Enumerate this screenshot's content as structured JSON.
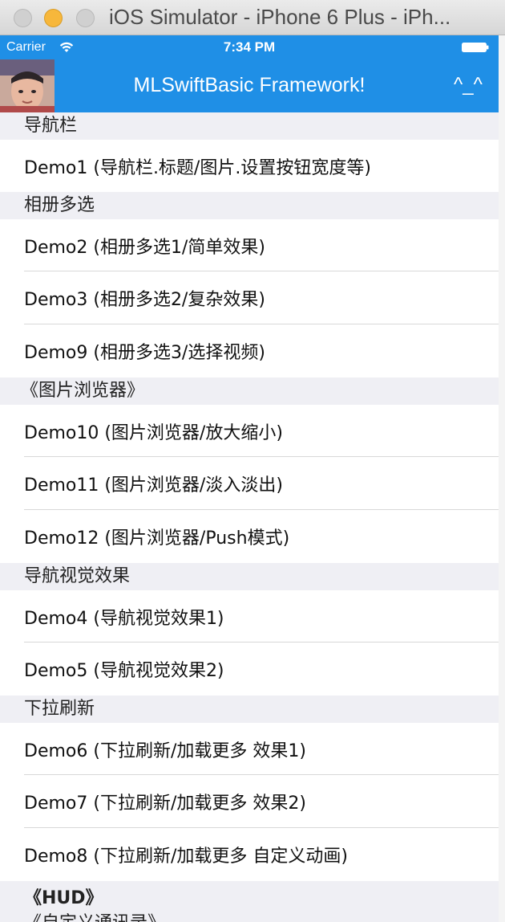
{
  "window": {
    "title": "iOS Simulator - iPhone 6 Plus - iPh..."
  },
  "status_bar": {
    "carrier": "Carrier",
    "time": "7:34 PM"
  },
  "nav_bar": {
    "title": "MLSwiftBasic Framework!",
    "right_button": "^_^",
    "color": "#1f8fe6"
  },
  "sections": [
    {
      "header": "导航栏",
      "rows": [
        "Demo1 (导航栏.标题/图片.设置按钮宽度等)"
      ]
    },
    {
      "header": "相册多选",
      "rows": [
        "Demo2 (相册多选1/简单效果)",
        "Demo3 (相册多选2/复杂效果)",
        "Demo9 (相册多选3/选择视频)"
      ]
    },
    {
      "header": "《图片浏览器》",
      "rows": [
        "Demo10 (图片浏览器/放大缩小)",
        "Demo11 (图片浏览器/淡入淡出)",
        "Demo12 (图片浏览器/Push模式)"
      ]
    },
    {
      "header": "导航视觉效果",
      "rows": [
        "Demo4 (导航视觉效果1)",
        "Demo5 (导航视觉效果2)"
      ]
    },
    {
      "header": "下拉刷新",
      "rows": [
        "Demo6 (下拉刷新/加载更多 效果1)",
        "Demo7 (下拉刷新/加载更多 效果2)",
        "Demo8 (下拉刷新/加载更多 自定义动画)"
      ]
    }
  ],
  "bottom_headers": {
    "hud": "《HUD》",
    "contacts": "《自定义通讯录》"
  }
}
